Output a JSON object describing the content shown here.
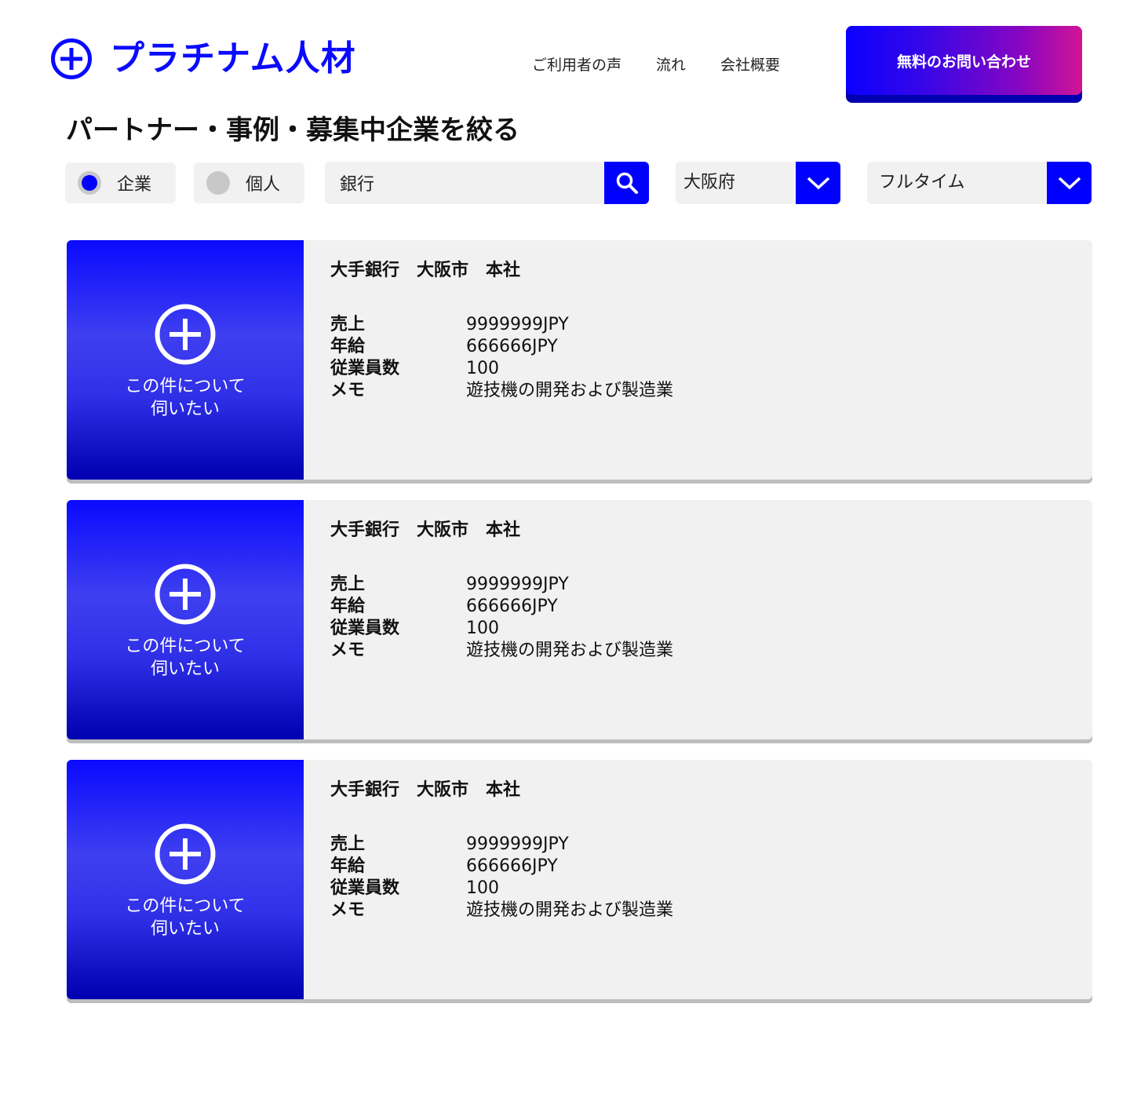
{
  "brand": {
    "name": "プラチナム人材",
    "color": "#0a0aff"
  },
  "nav": {
    "items": [
      "ご利用者の声",
      "流れ",
      "会社概要"
    ]
  },
  "cta": {
    "label": "無料のお問い合わせ"
  },
  "page_title": "パートナー・事例・募集中企業を絞る",
  "filters": {
    "type_options": [
      {
        "label": "企業",
        "selected": true
      },
      {
        "label": "個人",
        "selected": false
      }
    ],
    "search": {
      "value": "銀行",
      "icon": "search-icon"
    },
    "prefecture": {
      "value": "大阪府"
    },
    "employment": {
      "value": "フルタイム"
    }
  },
  "results": [
    {
      "title": "大手銀行　大阪市　本社",
      "ask_label_line1": "この件について",
      "ask_label_line2": "伺いたい",
      "fields": [
        {
          "label": "売上",
          "value": "9999999JPY"
        },
        {
          "label": "年給",
          "value": "666666JPY"
        },
        {
          "label": "従業員数",
          "value": "100"
        },
        {
          "label": "メモ",
          "value": "遊技機の開発および製造業"
        }
      ]
    },
    {
      "title": "大手銀行　大阪市　本社",
      "ask_label_line1": "この件について",
      "ask_label_line2": "伺いたい",
      "fields": [
        {
          "label": "売上",
          "value": "9999999JPY"
        },
        {
          "label": "年給",
          "value": "666666JPY"
        },
        {
          "label": "従業員数",
          "value": "100"
        },
        {
          "label": "メモ",
          "value": "遊技機の開発および製造業"
        }
      ]
    },
    {
      "title": "大手銀行　大阪市　本社",
      "ask_label_line1": "この件について",
      "ask_label_line2": "伺いたい",
      "fields": [
        {
          "label": "売上",
          "value": "9999999JPY"
        },
        {
          "label": "年給",
          "value": "666666JPY"
        },
        {
          "label": "従業員数",
          "value": "100"
        },
        {
          "label": "メモ",
          "value": "遊技機の開発および製造業"
        }
      ]
    }
  ]
}
